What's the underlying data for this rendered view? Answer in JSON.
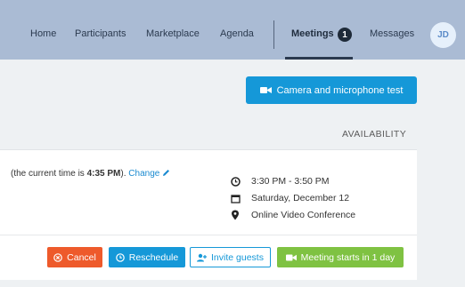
{
  "nav": {
    "items": [
      {
        "label": "Home"
      },
      {
        "label": "Participants"
      },
      {
        "label": "Marketplace"
      },
      {
        "label": "Agenda"
      }
    ],
    "meetings_label": "Meetings",
    "meetings_badge": "1",
    "messages_label": "Messages",
    "avatar_initials": "JD"
  },
  "camera_test": {
    "label": "Camera and microphone test",
    "icon": "video-camera-icon"
  },
  "availability_label": "AVAILABILITY",
  "time_note": {
    "prefix": "(the current time is ",
    "time": "4:35 PM",
    "suffix": ").",
    "change_label": "Change"
  },
  "meeting": {
    "time_range": "3:30 PM - 3:50 PM",
    "date": "Saturday, December 12",
    "location": "Online Video Conference"
  },
  "actions": {
    "cancel": "Cancel",
    "reschedule": "Reschedule",
    "invite": "Invite guests",
    "meeting_starts": "Meeting starts in 1 day"
  },
  "colors": {
    "navbar": "#aabbd4",
    "primary": "#1598d8",
    "danger": "#ee5a2b",
    "success": "#7fc242"
  }
}
